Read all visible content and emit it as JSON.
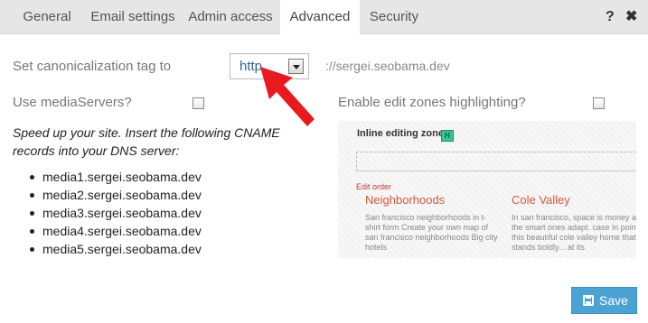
{
  "tabs": {
    "general": "General",
    "email": "Email settings",
    "admin": "Admin access",
    "advanced": "Advanced",
    "security": "Security",
    "active": "Advanced"
  },
  "toolbar": {
    "help_glyph": "?",
    "close_glyph": "✖"
  },
  "canonicalization": {
    "label": "Set canonicalization tag to",
    "selected": "http",
    "domain_suffix": "://sergei.seobama.dev"
  },
  "media_servers": {
    "label": "Use mediaServers?",
    "checked": false
  },
  "edit_zones": {
    "label": "Enable edit zones highlighting?",
    "checked": false
  },
  "cname_info": "Speed up your site. Insert the following CNAME records into your DNS server:",
  "cname_records": [
    "media1.sergei.seobama.dev",
    "media2.sergei.seobama.dev",
    "media3.sergei.seobama.dev",
    "media4.sergei.seobama.dev",
    "media5.sergei.seobama.dev"
  ],
  "preview": {
    "zone_label": "Inline editing zone",
    "zone_badge": "H",
    "edit_order": "Edit order",
    "col1_title": "Neighborhoods",
    "col1_text": "San francisco neighborhoods in t-shirt form Create your own map of san francisco neighborhoods Big city hotels",
    "col2_title": "Cole Valley",
    "col2_text": "In san francisco, space is money and the smart ones adapt. case in point this beautiful cole valley home that stands boldly... at its"
  },
  "save_button": {
    "label": "Save"
  },
  "colors": {
    "accent": "#4aa3d3",
    "link": "#2a6496",
    "arrow": "#e8191f",
    "badge": "#3dc39a"
  }
}
